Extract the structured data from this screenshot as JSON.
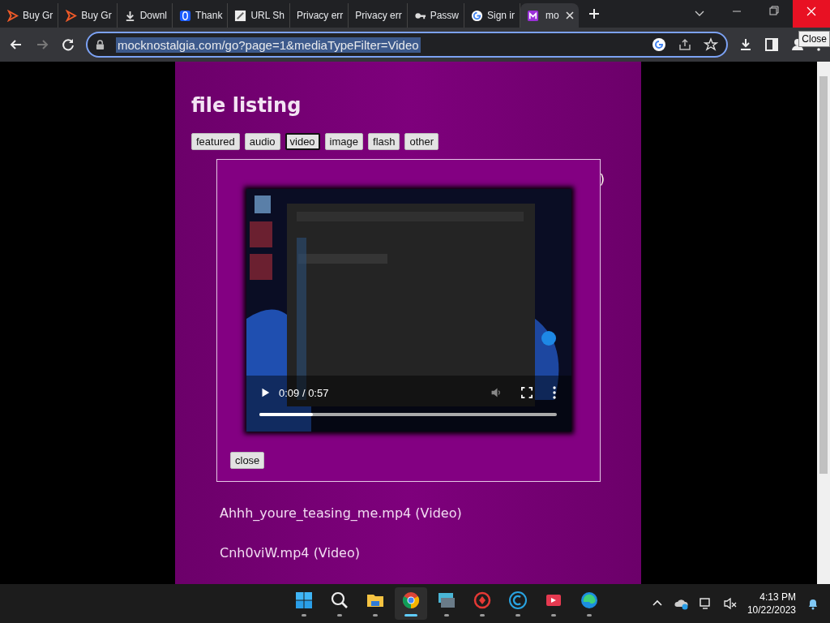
{
  "browser": {
    "tabs": [
      {
        "label": "Buy Gr",
        "kind": "play",
        "selected": false
      },
      {
        "label": "Buy Gr",
        "kind": "play",
        "selected": false
      },
      {
        "label": "Downl",
        "kind": "download",
        "selected": false
      },
      {
        "label": "Thank",
        "kind": "blue",
        "selected": false
      },
      {
        "label": "URL Sh",
        "kind": "page",
        "selected": false
      },
      {
        "label": "Privacy err",
        "kind": "plain",
        "selected": false
      },
      {
        "label": "Privacy err",
        "kind": "plain",
        "selected": false
      },
      {
        "label": "Passw",
        "kind": "key",
        "selected": false
      },
      {
        "label": "Sign ir",
        "kind": "google",
        "selected": false
      },
      {
        "label": "mo",
        "kind": "app",
        "selected": true
      }
    ],
    "url": "mocknostalgia.com/go?page=1&mediaTypeFilter=Video",
    "tooltip": "Close"
  },
  "page": {
    "title": "file listing",
    "filters": [
      {
        "label": "featured",
        "selected": false
      },
      {
        "label": "audio",
        "selected": false
      },
      {
        "label": "video",
        "selected": true
      },
      {
        "label": "image",
        "selected": false
      },
      {
        "label": "flash",
        "selected": false
      },
      {
        "label": "other",
        "selected": false
      }
    ],
    "peek_text": ")",
    "player": {
      "time": "0:09 / 0:57",
      "level": 0.18
    },
    "close_label": "close",
    "files": [
      "Ahhh_youre_teasing_me.mp4 (Video)",
      "Cnh0viW.mp4 (Video)"
    ]
  },
  "taskbar": {
    "apps": [
      {
        "kind": "start",
        "selected": false
      },
      {
        "kind": "search",
        "selected": false
      },
      {
        "kind": "folder",
        "selected": false
      },
      {
        "kind": "chrome",
        "selected": true
      },
      {
        "kind": "keyboard",
        "selected": false
      },
      {
        "kind": "red",
        "selected": false
      },
      {
        "kind": "ccleaner",
        "selected": false
      },
      {
        "kind": "recorder",
        "selected": false
      },
      {
        "kind": "edge",
        "selected": false
      }
    ],
    "time": "4:13 PM",
    "date": "10/22/2023"
  }
}
